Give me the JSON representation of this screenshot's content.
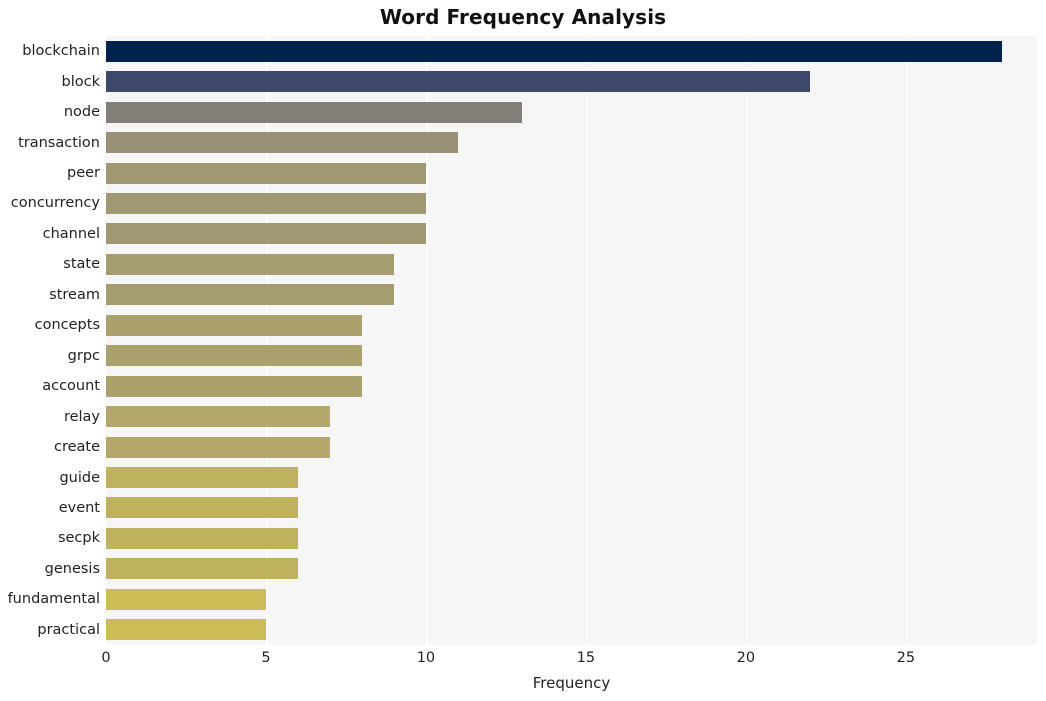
{
  "chart_data": {
    "type": "bar",
    "orientation": "horizontal",
    "title": "Word Frequency Analysis",
    "xlabel": "Frequency",
    "ylabel": "",
    "categories": [
      "blockchain",
      "block",
      "node",
      "transaction",
      "peer",
      "concurrency",
      "channel",
      "state",
      "stream",
      "concepts",
      "grpc",
      "account",
      "relay",
      "create",
      "guide",
      "event",
      "secpk",
      "genesis",
      "fundamental",
      "practical"
    ],
    "values": [
      28,
      22,
      13,
      11,
      10,
      10,
      10,
      9,
      9,
      8,
      8,
      8,
      7,
      7,
      6,
      6,
      6,
      6,
      5,
      5
    ],
    "bar_colors": [
      "#00234c",
      "#3d486b",
      "#827f79",
      "#989177",
      "#a09872",
      "#a09872",
      "#a09872",
      "#a59c70",
      "#a59c70",
      "#aaa16d",
      "#aaa16d",
      "#aaa16d",
      "#b2a869",
      "#b2a869",
      "#bfb25f",
      "#bfb25f",
      "#bfb25f",
      "#bfb25f",
      "#cbbc56",
      "#cbbc56"
    ],
    "xticks": [
      0,
      5,
      10,
      15,
      20,
      25
    ],
    "xtick_labels": [
      "0",
      "5",
      "10",
      "15",
      "20",
      "25"
    ],
    "xlim": [
      0,
      29.1
    ],
    "grid": "vertical-white",
    "legend": null,
    "plot_background": "#f6f6f6",
    "figure_background": "#ffffff"
  }
}
